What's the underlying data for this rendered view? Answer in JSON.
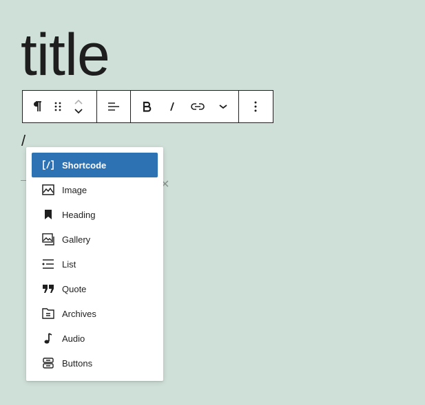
{
  "editor": {
    "post_title": "title",
    "typed_text": "/"
  },
  "toolbar": {
    "groups": [
      {
        "name": "block",
        "items": [
          "paragraph-icon",
          "drag-handle-icon",
          "move-up-icon",
          "move-down-icon"
        ]
      },
      {
        "name": "align",
        "items": [
          "align-left-icon"
        ]
      },
      {
        "name": "format",
        "items": [
          "bold-icon",
          "italic-icon",
          "link-icon",
          "chevron-down-icon"
        ]
      },
      {
        "name": "more",
        "items": [
          "more-options-icon"
        ]
      }
    ]
  },
  "inserter": {
    "items": [
      {
        "label": "Shortcode",
        "icon": "shortcode-icon",
        "selected": true
      },
      {
        "label": "Image",
        "icon": "image-icon"
      },
      {
        "label": "Heading",
        "icon": "bookmark-icon"
      },
      {
        "label": "Gallery",
        "icon": "gallery-icon"
      },
      {
        "label": "List",
        "icon": "list-icon"
      },
      {
        "label": "Quote",
        "icon": "quote-icon"
      },
      {
        "label": "Archives",
        "icon": "archive-icon"
      },
      {
        "label": "Audio",
        "icon": "audio-note-icon"
      },
      {
        "label": "Buttons",
        "icon": "buttons-icon"
      }
    ]
  },
  "colors": {
    "background": "#cfe0d8",
    "accent": "#2d72b3",
    "text": "#1e1e1e"
  }
}
